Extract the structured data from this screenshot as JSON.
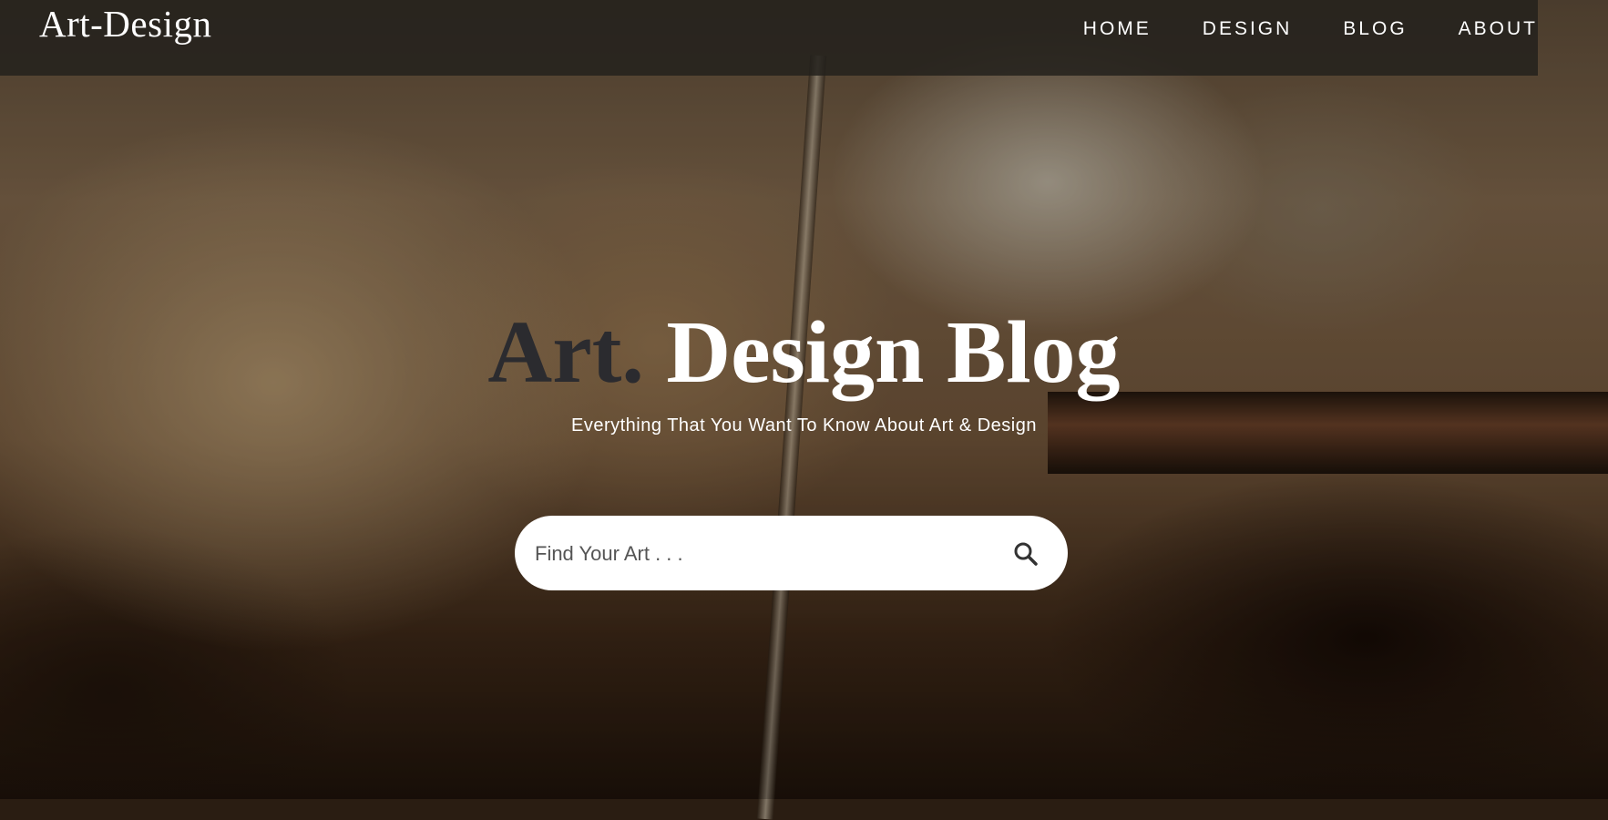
{
  "brand": {
    "title": "Art-Design"
  },
  "nav": {
    "items": [
      {
        "label": "HOME"
      },
      {
        "label": "DESIGN"
      },
      {
        "label": "BLOG"
      },
      {
        "label": "ABOUT"
      }
    ]
  },
  "hero": {
    "title_accent": "Art.",
    "title_main": "Design Blog",
    "subtitle": "Everything That You Want To Know About Art & Design",
    "search": {
      "placeholder": "Find Your Art . . .",
      "value": "",
      "icon": "search-icon"
    }
  },
  "colors": {
    "nav_background": "#23211c",
    "accent_dark": "#2b2b2f",
    "text_light": "#ffffff",
    "search_background": "#ffffff"
  }
}
